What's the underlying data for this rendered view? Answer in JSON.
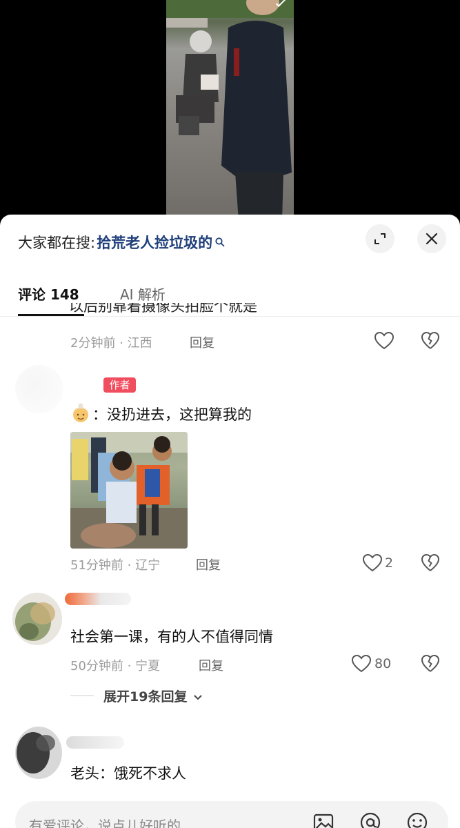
{
  "search": {
    "prefix": "大家都在搜:",
    "term": "拾荒老人捡垃圾的"
  },
  "tabs": [
    {
      "label": "评论 148",
      "active": true
    },
    {
      "label": "AI 解析",
      "active": false
    }
  ],
  "comments": [
    {
      "text_cut": "以后别靠着摄像头拍脸个就是",
      "time": "2分钟前 · 江西",
      "reply_label": "回复",
      "likes": ""
    },
    {
      "badge": "作者",
      "text": "：没扔进去，这把算我的",
      "emoji": "old-woman-emoji",
      "time": "51分钟前 · 辽宁",
      "reply_label": "回复",
      "likes": "2"
    },
    {
      "text": "社会第一课，有的人不值得同情",
      "time": "50分钟前 · 宁夏",
      "reply_label": "回复",
      "likes": "80",
      "expand_label": "展开19条回复"
    },
    {
      "text": "老头：饿死不求人"
    }
  ],
  "input": {
    "placeholder": "有爱评论，说点儿好听的"
  },
  "colors": {
    "badge": "#f04e5f",
    "search_term": "#1f3f7a"
  }
}
